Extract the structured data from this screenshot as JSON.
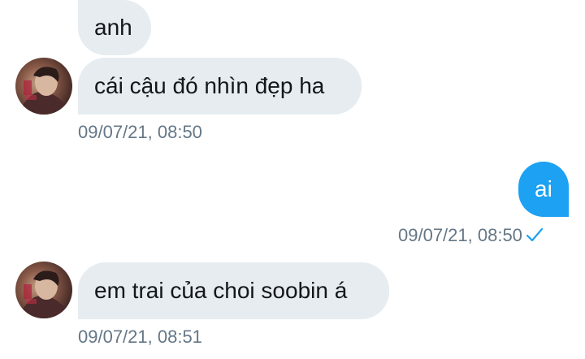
{
  "conversation": {
    "messages": [
      {
        "text": "anh",
        "direction": "incoming"
      },
      {
        "text": "cái cậu đó nhìn đẹp ha",
        "direction": "incoming",
        "timestamp": "09/07/21, 08:50"
      },
      {
        "text": "ai",
        "direction": "outgoing",
        "timestamp": "09/07/21, 08:50",
        "status": "sent-check-icon"
      },
      {
        "text": "em trai của choi soobin á",
        "direction": "incoming",
        "timestamp": "09/07/21, 08:51"
      }
    ]
  },
  "colors": {
    "incoming_bubble": "#e6ecf0",
    "outgoing_bubble": "#1da1f2",
    "timestamp_text": "#657786",
    "check_icon": "#1da1f2"
  },
  "icons": {
    "avatar": "contact-avatar-photo",
    "read_status": "check-icon"
  }
}
